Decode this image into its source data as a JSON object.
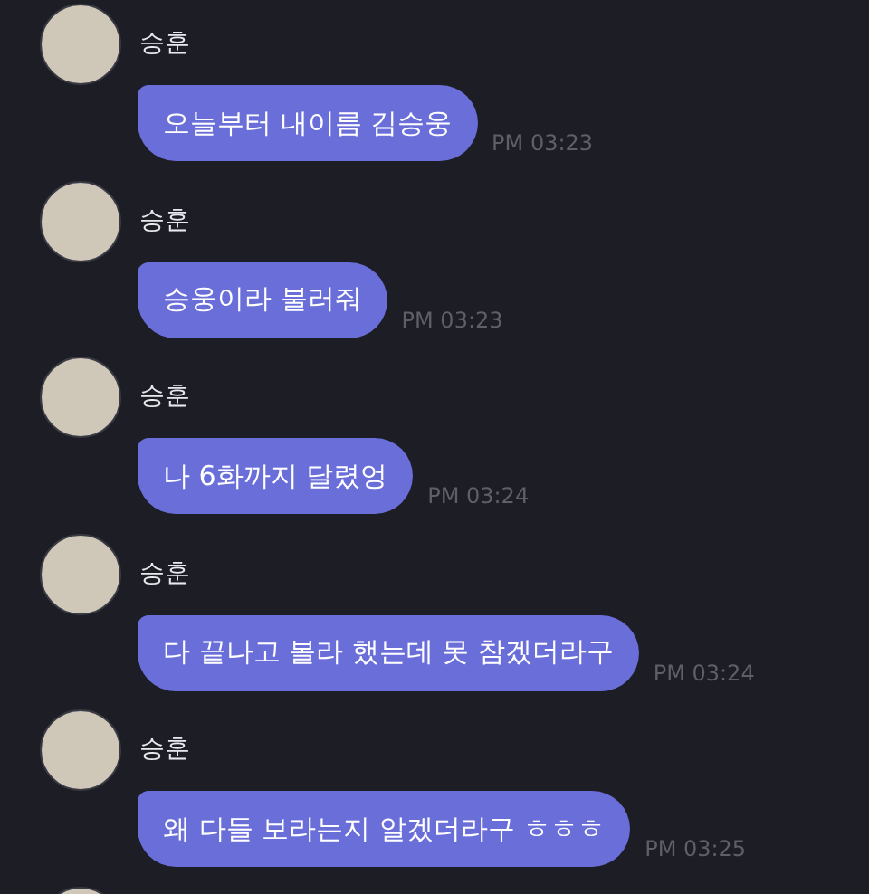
{
  "messages": [
    {
      "sender": "승훈",
      "text": "오늘부터 내이름 김승웅",
      "time": "PM 03:23"
    },
    {
      "sender": "승훈",
      "text": "승웅이라 불러줘",
      "time": "PM 03:23"
    },
    {
      "sender": "승훈",
      "text": "나 6화까지 달렸엉",
      "time": "PM 03:24"
    },
    {
      "sender": "승훈",
      "text": "다 끝나고 볼라 했는데 못 참겠더라구",
      "time": "PM 03:24"
    },
    {
      "sender": "승훈",
      "text": "왜 다들 보라는지 알겠더라구 ㅎㅎㅎ",
      "time": "PM 03:25"
    }
  ]
}
